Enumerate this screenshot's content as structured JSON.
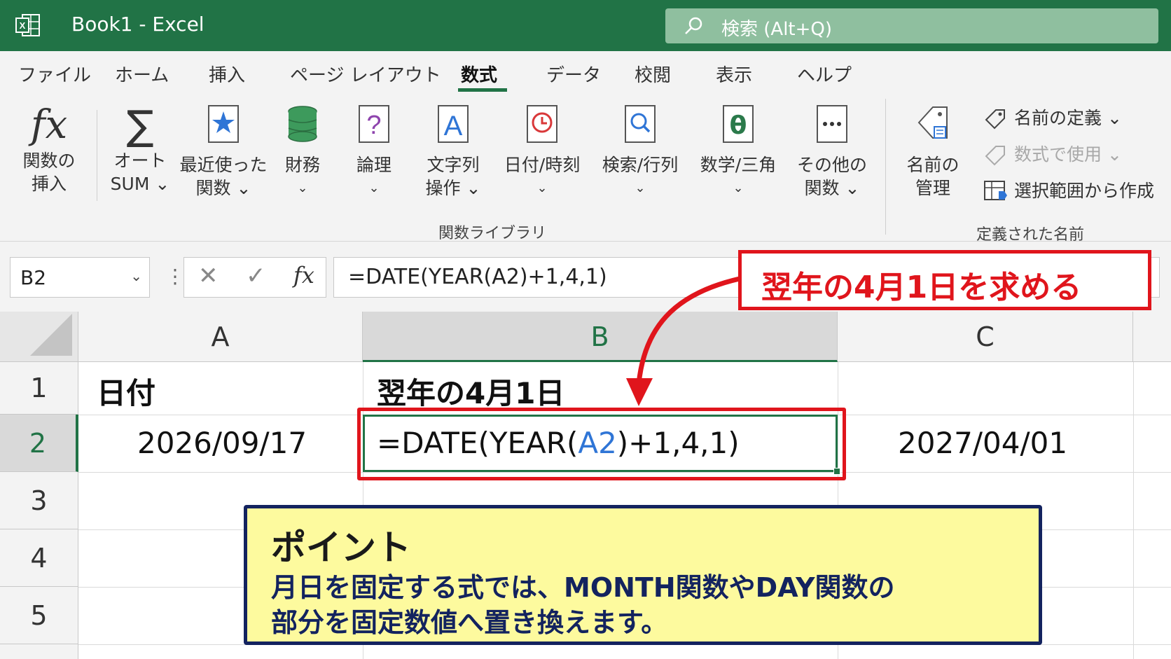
{
  "titlebar": {
    "title": "Book1  -  Excel",
    "search_placeholder": "検索 (Alt+Q)"
  },
  "ribbon": {
    "tabs": [
      "ファイル",
      "ホーム",
      "挿入",
      "ページ レイアウト",
      "数式",
      "データ",
      "校閲",
      "表示",
      "ヘルプ"
    ],
    "active_tab": "数式",
    "buttons": [
      {
        "line1": "関数の",
        "line2": "挿入"
      },
      {
        "line1": "オート",
        "line2": "SUM ⌄"
      },
      {
        "line1": "最近使った",
        "line2": "関数 ⌄"
      },
      {
        "line1": "財務",
        "line2": "⌄"
      },
      {
        "line1": "論理",
        "line2": "⌄"
      },
      {
        "line1": "文字列",
        "line2": "操作 ⌄"
      },
      {
        "line1": "日付/時刻",
        "line2": "⌄"
      },
      {
        "line1": "検索/行列",
        "line2": "⌄"
      },
      {
        "line1": "数学/三角",
        "line2": "⌄"
      },
      {
        "line1": "その他の",
        "line2": "関数 ⌄"
      },
      {
        "line1": "名前の",
        "line2": "管理"
      }
    ],
    "group_library": "関数ライブラリ",
    "group_names": "定義された名前",
    "define_name": "名前の定義 ⌄",
    "use_in_formula": "数式で使用 ⌄",
    "create_from_selection": "選択範囲から作成"
  },
  "formula_bar": {
    "name_box": "B2",
    "formula": "=DATE(YEAR(A2)+1,4,1)"
  },
  "grid": {
    "columns": [
      "A",
      "B",
      "C"
    ],
    "rows": [
      "1",
      "2",
      "3",
      "4",
      "5"
    ],
    "a1": "日付",
    "b1": "翌年の4月1日",
    "a2": "2026/09/17",
    "b2_prefix": "=DATE(YEAR(",
    "b2_ref": "A2",
    "b2_suffix": ")+1,4,1)",
    "c2": "2027/04/01"
  },
  "callout": {
    "text": "翌年の4月1日を求める",
    "color": "#e0151c"
  },
  "point": {
    "title": "ポイント",
    "line1": "月日を固定する式では、MONTH関数やDAY関数の",
    "line2": "部分を固定数値へ置き換えます。"
  },
  "colors": {
    "excel_green": "#217346",
    "callout_red": "#e0151c",
    "point_bg": "#fdfa9e",
    "point_border": "#13235f"
  }
}
